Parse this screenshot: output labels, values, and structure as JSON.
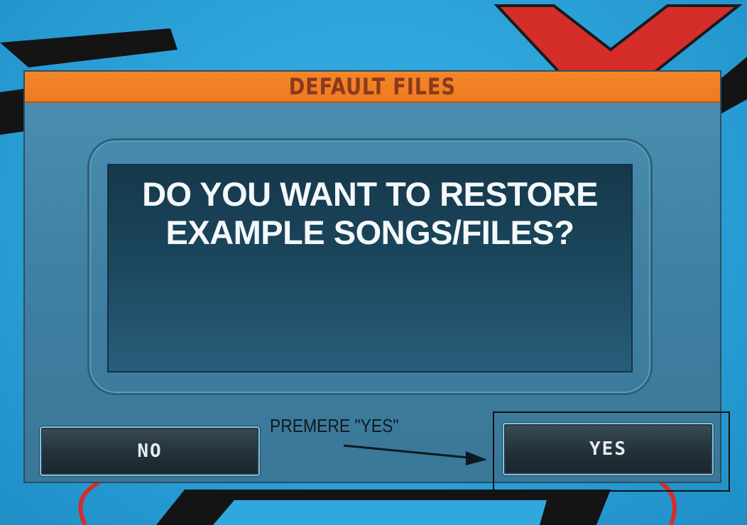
{
  "dialog": {
    "title": "DEFAULT FILES",
    "message_lines": [
      "DO YOU WANT TO RESTORE",
      "EXAMPLE SONGS/FILES?"
    ]
  },
  "buttons": {
    "no_label": "NO",
    "yes_label": "YES"
  },
  "annotation": {
    "text": "PREMERE \"YES\""
  },
  "colors": {
    "background": "#2fa8df",
    "title_bar": "#f4862a",
    "title_text": "#8a3a1c",
    "dialog_body": "#4b8fb1",
    "message_panel": "#1b465c",
    "button_face": "#22313a",
    "button_border": "#7fc2e3"
  }
}
